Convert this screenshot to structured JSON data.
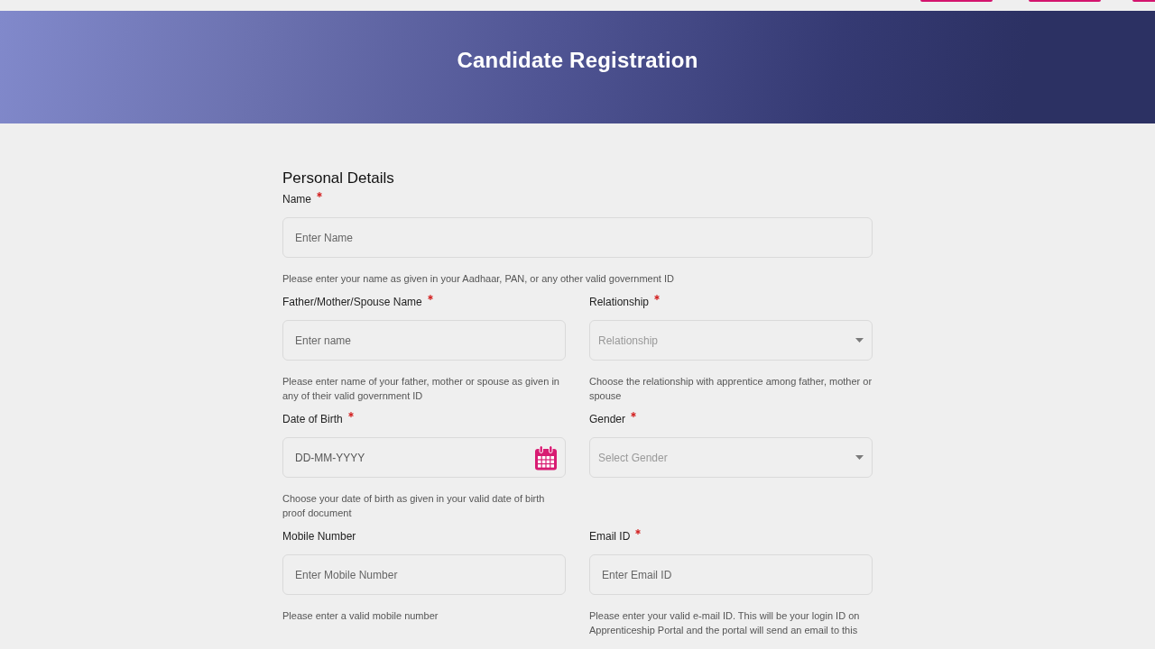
{
  "header": {
    "title": "Candidate Registration"
  },
  "section": {
    "title": "Personal Details"
  },
  "rows": [
    {
      "fields": [
        {
          "kind": "text",
          "label": "Name",
          "required": true,
          "placeholder": "Enter Name",
          "hint": "Please enter your name as given in your Aadhaar, PAN, or any other valid government ID"
        }
      ]
    },
    {
      "fields": [
        {
          "kind": "text",
          "label": "Father/Mother/Spouse Name",
          "required": true,
          "placeholder": "Enter name",
          "hint": "Please enter name of your father, mother or spouse as given in any of their valid government ID"
        },
        {
          "kind": "select",
          "label": "Relationship",
          "required": true,
          "placeholder": "Relationship",
          "hint": "Choose the relationship with apprentice among father, mother or spouse"
        }
      ]
    },
    {
      "fields": [
        {
          "kind": "date",
          "label": "Date of Birth",
          "required": true,
          "placeholder": "DD-MM-YYYY",
          "hint": "Choose your date of birth as given in your valid date of birth proof document"
        },
        {
          "kind": "select",
          "label": "Gender",
          "required": true,
          "placeholder": "Select Gender"
        }
      ]
    },
    {
      "fields": [
        {
          "kind": "text",
          "label": "Mobile Number",
          "required": false,
          "placeholder": "Enter Mobile Number",
          "hint": "Please enter a valid mobile number"
        },
        {
          "kind": "text",
          "label": "Email ID",
          "required": true,
          "placeholder": "Enter Email ID",
          "hint": "Please enter your valid e-mail ID. This will be your login ID on Apprenticeship Portal and the portal will send an email to this"
        }
      ]
    }
  ]
}
